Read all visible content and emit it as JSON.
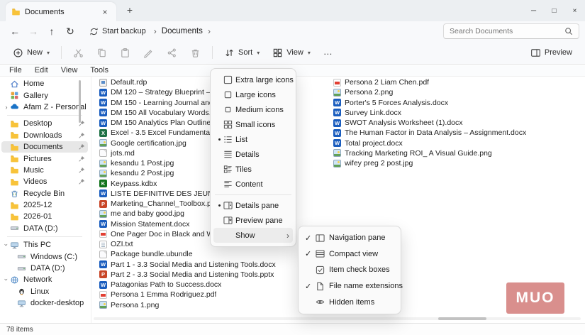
{
  "window": {
    "tab_title": "Documents"
  },
  "icons": {
    "close": "×",
    "minimize": "─",
    "maximize": "□",
    "new_tab": "+",
    "back": "←",
    "forward": "→",
    "up": "↑",
    "refresh": "↻",
    "breadcrumb_separator": "›",
    "dropdown_chevron": "▾",
    "more": "…",
    "submenu_arrow": "›",
    "radio_bullet": "•",
    "checkmark": "✓"
  },
  "colors": {
    "accent": "#1a73c7",
    "watermark": "#d98f8d",
    "word": "#1a5dbe",
    "excel": "#1e7145",
    "powerpoint": "#c84627",
    "pdf": "#e23f33"
  },
  "navbar": {
    "backup_label": "Start backup",
    "location": "Documents",
    "search_placeholder": "Search Documents"
  },
  "toolbar": {
    "new_label": "New",
    "sort_label": "Sort",
    "view_label": "View",
    "preview_label": "Preview"
  },
  "menubar": {
    "items": [
      {
        "label": "File"
      },
      {
        "label": "Edit"
      },
      {
        "label": "View"
      },
      {
        "label": "Tools"
      }
    ]
  },
  "sidebar": {
    "items": [
      {
        "label": "Home",
        "icon": "home"
      },
      {
        "label": "Gallery",
        "icon": "gallery"
      },
      {
        "label": "Afam Z - Personal",
        "icon": "onedrive",
        "expand": "right"
      },
      {
        "type": "separator"
      },
      {
        "label": "Desktop",
        "icon": "desktop",
        "pinned": true
      },
      {
        "label": "Downloads",
        "icon": "downloads",
        "pinned": true
      },
      {
        "label": "Documents",
        "icon": "documents",
        "pinned": true,
        "selected": true
      },
      {
        "label": "Pictures",
        "icon": "pictures",
        "pinned": true
      },
      {
        "label": "Music",
        "icon": "music",
        "pinned": true
      },
      {
        "label": "Videos",
        "icon": "videos",
        "pinned": true
      },
      {
        "label": "Recycle Bin",
        "icon": "recycle-bin"
      },
      {
        "label": "2025-12",
        "icon": "folder"
      },
      {
        "label": "2026-01",
        "icon": "folder"
      },
      {
        "label": "DATA (D:)",
        "icon": "drive"
      },
      {
        "type": "separator"
      },
      {
        "label": "This PC",
        "icon": "pc",
        "expand": "down"
      },
      {
        "label": "Windows (C:)",
        "icon": "drive",
        "indent": true
      },
      {
        "label": "DATA (D:)",
        "icon": "drive",
        "indent": true
      },
      {
        "label": "Network",
        "icon": "network",
        "expand": "down"
      },
      {
        "label": "Linux",
        "icon": "linux",
        "indent": true
      },
      {
        "label": "docker-desktop",
        "icon": "pc",
        "indent": true
      }
    ]
  },
  "files": {
    "col1": [
      {
        "name": "Default.rdp",
        "type": "rdp"
      },
      {
        "name": "DM 120 – Strategy Blueprint – Referenc...",
        "type": "docx"
      },
      {
        "name": "DM 150 - Learning Journal and Toolbox...",
        "type": "docx"
      },
      {
        "name": "DM 150 All Vocabulary Words.docx",
        "type": "docx"
      },
      {
        "name": "DM 150 Analytics Plan Outline_a.docx",
        "type": "docx"
      },
      {
        "name": "Excel - 3.5 Excel Fundamentals and Dash...",
        "type": "xlsx"
      },
      {
        "name": "Google certification.jpg",
        "type": "img"
      },
      {
        "name": "jots.md",
        "type": "file"
      },
      {
        "name": "kesandu 1 Post.jpg",
        "type": "img"
      },
      {
        "name": "kesandu 2 Post.jpg",
        "type": "img"
      },
      {
        "name": "Keypass.kdbx",
        "type": "kdbx"
      },
      {
        "name": "LISTE DEFINITIVE DES JEUNES ADULTES...",
        "type": "docx"
      },
      {
        "name": "Marketing_Channel_Toolbox.pptx",
        "type": "pptx"
      },
      {
        "name": "me and baby good.jpg",
        "type": "img"
      },
      {
        "name": "Mission Statement.docx",
        "type": "docx"
      },
      {
        "name": "One Pager Doc in Black and White Blue...",
        "type": "pdf"
      },
      {
        "name": "OZI.txt",
        "type": "txt"
      },
      {
        "name": "Package bundle.ubundle",
        "type": "file"
      },
      {
        "name": "Part 1 - 3.3 Social Media and Listening Tools.docx",
        "type": "docx"
      },
      {
        "name": "Part 2 - 3.3 Social Media and Listening Tools.pptx",
        "type": "pptx"
      },
      {
        "name": "Patagonias Path to Success.docx",
        "type": "docx"
      },
      {
        "name": "Persona 1 Emma Rodriguez.pdf",
        "type": "pdf"
      },
      {
        "name": "Persona 1.png",
        "type": "img"
      }
    ],
    "col2": [
      {
        "name": "Persona 2 Liam Chen.pdf",
        "type": "pdf"
      },
      {
        "name": "Persona 2.png",
        "type": "img"
      },
      {
        "name": "Porter's 5 Forces Analysis.docx",
        "type": "docx"
      },
      {
        "name": "Survey Link.docx",
        "type": "docx"
      },
      {
        "name": "SWOT Analysis Worksheet (1).docx",
        "type": "docx"
      },
      {
        "name": "The Human Factor in Data Analysis – Assignment.docx",
        "type": "docx"
      },
      {
        "name": "Total project.docx",
        "type": "docx"
      },
      {
        "name": "Tracking Marketing ROI_ A Visual Guide.png",
        "type": "img"
      },
      {
        "name": "wifey preg 2 post.jpg",
        "type": "img"
      }
    ]
  },
  "view_menu": {
    "items": [
      {
        "label": "Extra large icons",
        "icon": "icons-xl"
      },
      {
        "label": "Large icons",
        "icon": "icons-lg"
      },
      {
        "label": "Medium icons",
        "icon": "icons-md"
      },
      {
        "label": "Small icons",
        "icon": "icons-sm"
      },
      {
        "label": "List",
        "icon": "list",
        "radio": true
      },
      {
        "label": "Details",
        "icon": "details"
      },
      {
        "label": "Tiles",
        "icon": "tiles"
      },
      {
        "label": "Content",
        "icon": "content"
      },
      {
        "type": "separator"
      },
      {
        "label": "Details pane",
        "icon": "details-pane",
        "radio": true
      },
      {
        "label": "Preview pane",
        "icon": "preview-pane"
      },
      {
        "label": "Show",
        "submenu": true,
        "highlight": true
      }
    ]
  },
  "show_submenu": {
    "items": [
      {
        "label": "Navigation pane",
        "checked": true,
        "icon": "nav-pane"
      },
      {
        "label": "Compact view",
        "checked": true,
        "icon": "compact"
      },
      {
        "label": "Item check boxes",
        "checked": false,
        "icon": "checkboxes"
      },
      {
        "label": "File name extensions",
        "checked": true,
        "icon": "extensions"
      },
      {
        "label": "Hidden items",
        "checked": false,
        "icon": "hidden"
      }
    ]
  },
  "statusbar": {
    "items_count": "78 items"
  },
  "watermark": {
    "text": "MUO"
  }
}
